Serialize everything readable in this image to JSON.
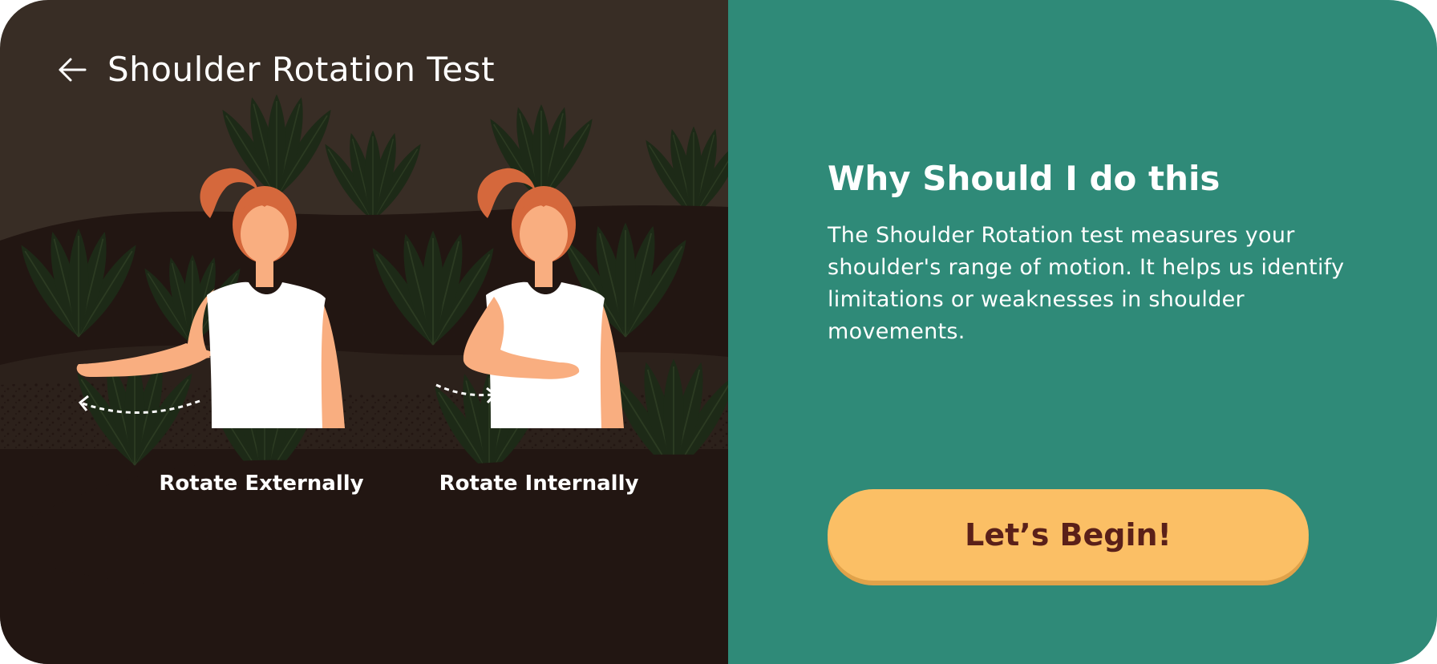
{
  "header": {
    "title": "Shoulder Rotation Test",
    "back_icon": "arrow-left-icon"
  },
  "illustration": {
    "captions": {
      "external": "Rotate Externally",
      "internal": "Rotate Internally"
    }
  },
  "info": {
    "heading": "Why Should I do this",
    "body": "The Shoulder Rotation test measures your shoulder's range of motion. It helps us identify limitations or weaknesses in shoulder movements."
  },
  "cta": {
    "label": "Let’s Begin!"
  },
  "colors": {
    "left_bg": "#382d25",
    "right_bg": "#2f8a78",
    "button_bg": "#fbbf65",
    "button_text": "#5a2019",
    "hair": "#d5683c",
    "skin": "#f9ae80",
    "shirt": "#ffffff",
    "leaf": "#1d2a17"
  }
}
